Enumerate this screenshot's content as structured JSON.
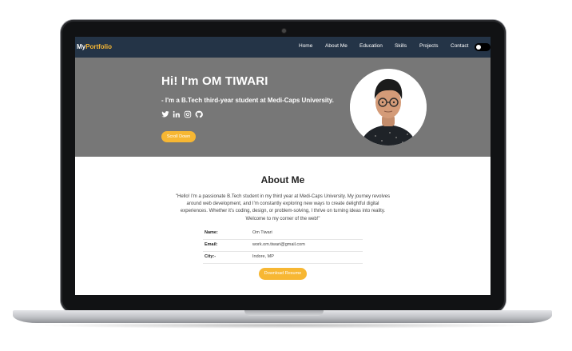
{
  "nav": {
    "brand_prefix": "My",
    "brand_accent": "Portfolio",
    "links": [
      "Home",
      "About Me",
      "Education",
      "Skills",
      "Projects",
      "Contact"
    ]
  },
  "hero": {
    "title": "Hi! I'm OM TIWARI",
    "subtitle": "- I'm a B.Tech third-year student at Medi-Caps University.",
    "social_icons": [
      "twitter-icon",
      "linkedin-icon",
      "instagram-icon",
      "github-icon"
    ],
    "scroll_button": "Scroll Down"
  },
  "about": {
    "title": "About Me",
    "text": "\"Hello! I'm a passionate B.Tech student in my third year at Medi-Caps University. My journey revolves around web development, and I'm constantly exploring new ways to create delightful digital experiences. Whether it's coding, design, or problem-solving, I thrive on turning ideas into reality. Welcome to my corner of the web!\"",
    "info": [
      {
        "label": "Name:",
        "value": "Om Tiwari"
      },
      {
        "label": "Email:",
        "value": "work.om.tiwari@gmail.com"
      },
      {
        "label": "City:-",
        "value": "Indore, MP"
      }
    ],
    "download_button": "Download Resume"
  },
  "colors": {
    "navbar": "#243447",
    "accent": "#f7b733",
    "hero_bg": "#777777"
  }
}
